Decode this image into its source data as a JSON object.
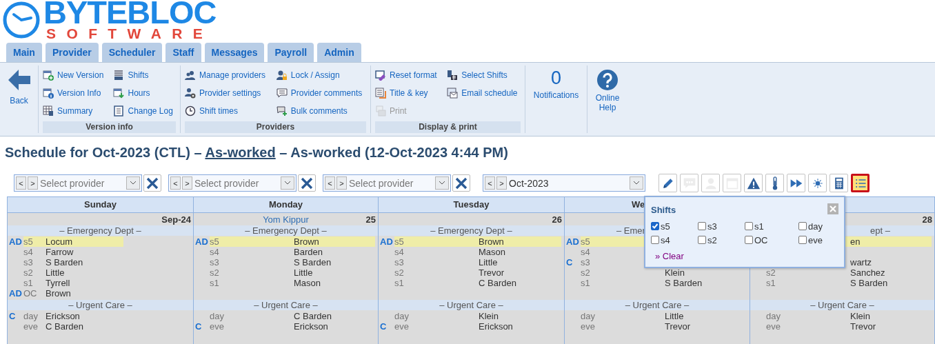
{
  "logo": {
    "word": "BYTEBLOC",
    "tagline": "SOFTWARE"
  },
  "tabs": [
    {
      "label": "Main"
    },
    {
      "label": "Provider"
    },
    {
      "label": "Scheduler"
    },
    {
      "label": "Staff"
    },
    {
      "label": "Messages"
    },
    {
      "label": "Payroll"
    },
    {
      "label": "Admin"
    }
  ],
  "ribbon": {
    "back": {
      "label": "Back"
    },
    "groups": [
      {
        "title": "Version info",
        "items": [
          {
            "kind": "calendar-plus",
            "label": "New Version",
            "disabled": false
          },
          {
            "kind": "lines",
            "label": "Shifts",
            "disabled": false
          },
          {
            "kind": "calendar-info",
            "label": "Version Info",
            "disabled": false
          },
          {
            "kind": "calendar-arrow",
            "label": "Hours",
            "disabled": false
          },
          {
            "kind": "table",
            "label": "Summary",
            "disabled": false
          },
          {
            "kind": "document",
            "label": "Change Log",
            "disabled": false
          }
        ]
      },
      {
        "title": "Providers",
        "items": [
          {
            "kind": "people",
            "label": "Manage providers",
            "disabled": false
          },
          {
            "kind": "person-lock",
            "label": "Lock / Assign",
            "disabled": false
          },
          {
            "kind": "people-gear",
            "label": "Provider settings",
            "disabled": false
          },
          {
            "kind": "speech",
            "label": "Provider comments",
            "disabled": false
          },
          {
            "kind": "clock",
            "label": "Shift times",
            "disabled": false
          },
          {
            "kind": "comment-plus",
            "label": "Bulk comments",
            "disabled": false
          }
        ]
      },
      {
        "title": "Display & print",
        "items": [
          {
            "kind": "eraser",
            "label": "Reset format",
            "disabled": false
          },
          {
            "kind": "grid",
            "label": "Select Shifts",
            "disabled": false
          },
          {
            "kind": "document-orange",
            "label": "Title & key",
            "disabled": false
          },
          {
            "kind": "envelope",
            "label": "Email schedule",
            "disabled": false
          },
          {
            "kind": "printer",
            "label": "Print",
            "disabled": true
          }
        ]
      }
    ],
    "notifications": {
      "count": "0",
      "label": "Notifications"
    },
    "help": {
      "label": "Online Help"
    }
  },
  "title": {
    "before": "Schedule for Oct-2023 (CTL) – ",
    "link": "As-worked",
    "after": " – As-worked (12-Oct-2023 4:44 PM)"
  },
  "filters": [
    {
      "prev": "<",
      "next": ">",
      "placeholder": "Select provider"
    },
    {
      "prev": "<",
      "next": ">",
      "placeholder": "Select provider"
    },
    {
      "prev": "<",
      "next": ">",
      "placeholder": "Select provider"
    }
  ],
  "month": {
    "prev": "<",
    "next": ">",
    "value": "Oct-2023"
  },
  "tools": [
    {
      "kind": "pencil",
      "disabled": false,
      "selected": false
    },
    {
      "kind": "comment",
      "disabled": true,
      "selected": false
    },
    {
      "kind": "person",
      "disabled": true,
      "selected": false
    },
    {
      "kind": "calendar",
      "disabled": true,
      "selected": false
    },
    {
      "kind": "warning",
      "disabled": false,
      "selected": false
    },
    {
      "kind": "thermometer",
      "disabled": false,
      "selected": false
    },
    {
      "kind": "fast-forward",
      "disabled": false,
      "selected": false
    },
    {
      "kind": "sun",
      "disabled": false,
      "selected": false
    },
    {
      "kind": "calculator",
      "disabled": false,
      "selected": false
    },
    {
      "kind": "list",
      "disabled": false,
      "selected": true
    }
  ],
  "calendar": {
    "days": [
      {
        "weekday": "Sunday",
        "date": "Sep-24",
        "sections": [
          {
            "title": "– Emergency Dept –",
            "rows": [
              {
                "mark": "AD",
                "shift": "s5",
                "name": "Locum",
                "highlighted": true
              },
              {
                "shift": "s4",
                "name": "Farrow",
                "highlighted": false
              },
              {
                "shift": "s3",
                "name": "S Barden",
                "highlighted": false
              },
              {
                "shift": "s2",
                "name": "Little",
                "highlighted": false
              },
              {
                "shift": "s1",
                "name": "Tyrrell",
                "highlighted": false
              },
              {
                "mark": "AD",
                "shift": "OC",
                "name": "Brown",
                "highlighted": false
              }
            ]
          },
          {
            "title": "– Urgent Care –",
            "rows": [
              {
                "mark": "C",
                "shift": "day",
                "name": "Erickson",
                "highlighted": false
              },
              {
                "shift": "eve",
                "name": "C Barden",
                "highlighted": false
              }
            ]
          }
        ]
      },
      {
        "weekday": "Monday",
        "holiday": "Yom Kippur",
        "date": "25",
        "sections": [
          {
            "title": "– Emergency Dept –",
            "rows": [
              {
                "mark": "AD",
                "shift": "s5",
                "name": "Brown",
                "highlighted": true
              },
              {
                "shift": "s4",
                "name": "Barden",
                "highlighted": false
              },
              {
                "shift": "s3",
                "name": "S Barden",
                "highlighted": false
              },
              {
                "shift": "s2",
                "name": "Little",
                "highlighted": false
              },
              {
                "shift": "s1",
                "name": "Mason",
                "highlighted": false
              }
            ]
          },
          {
            "title": "– Urgent Care –",
            "rows": [
              {
                "shift": "day",
                "name": "C Barden",
                "highlighted": false
              },
              {
                "mark": "C",
                "shift": "eve",
                "name": "Erickson",
                "highlighted": false
              }
            ]
          }
        ]
      },
      {
        "weekday": "Tuesday",
        "date": "26",
        "sections": [
          {
            "title": "– Emergency Dept –",
            "rows": [
              {
                "mark": "AD",
                "shift": "s5",
                "name": "Brown",
                "highlighted": true
              },
              {
                "shift": "s4",
                "name": "Mason",
                "highlighted": false
              },
              {
                "shift": "s3",
                "name": "Little",
                "highlighted": false
              },
              {
                "shift": "s2",
                "name": "Trevor",
                "highlighted": false
              },
              {
                "shift": "s1",
                "name": "C Barden",
                "highlighted": false
              }
            ]
          },
          {
            "title": "– Urgent Care –",
            "rows": [
              {
                "shift": "day",
                "name": "Klein",
                "highlighted": false
              },
              {
                "mark": "C",
                "shift": "eve",
                "name": "Erickson",
                "highlighted": false
              }
            ]
          }
        ]
      },
      {
        "weekday": "We",
        "sections": [
          {
            "title": "– Emer",
            "rows": [
              {
                "mark": "AD",
                "shift": "s5",
                "highlighted": true
              },
              {
                "shift": "s4",
                "highlighted": false
              },
              {
                "mark": "C",
                "shift": "s3",
                "highlighted": false
              },
              {
                "shift": "s2",
                "name": "Klein",
                "highlighted": false
              },
              {
                "shift": "s1",
                "name": "S Barden",
                "highlighted": false
              }
            ]
          },
          {
            "title": "– Urgent Care –",
            "rows": [
              {
                "shift": "day",
                "name": "Little",
                "highlighted": false
              },
              {
                "shift": "eve",
                "name": "Trevor",
                "highlighted": false
              }
            ]
          }
        ]
      },
      {
        "date": "28",
        "sections": [
          {
            "title": "ept –",
            "rows": [
              {
                "name": "en",
                "highlighted": true
              },
              {
                "highlighted": false
              },
              {
                "name": "wartz",
                "highlighted": false
              },
              {
                "shift": "s2",
                "name": "Sanchez",
                "highlighted": false
              },
              {
                "shift": "s1",
                "name": "S Barden",
                "highlighted": false
              }
            ]
          },
          {
            "title": "– Urgent Care –",
            "rows": [
              {
                "shift": "day",
                "name": "Klein",
                "highlighted": false
              },
              {
                "shift": "eve",
                "name": "Trevor",
                "highlighted": false
              }
            ]
          }
        ]
      }
    ]
  },
  "shift_popup": {
    "title": "Shifts",
    "options": [
      {
        "label": "s5",
        "checked": true
      },
      {
        "label": "s3",
        "checked": false
      },
      {
        "label": "s1",
        "checked": false
      },
      {
        "label": "day",
        "checked": false
      },
      {
        "label": "s4",
        "checked": false
      },
      {
        "label": "s2",
        "checked": false
      },
      {
        "label": "OC",
        "checked": false
      },
      {
        "label": "eve",
        "checked": false
      }
    ],
    "clear": "» Clear"
  }
}
